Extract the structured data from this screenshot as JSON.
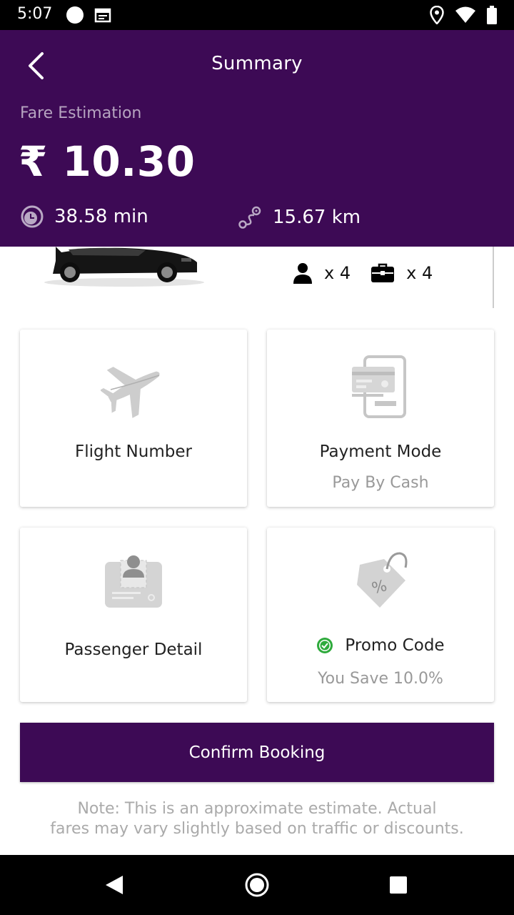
{
  "status_bar": {
    "time": "5:07",
    "icons": [
      "circle-icon",
      "calendar-icon",
      "location-icon",
      "wifi-icon",
      "battery-icon"
    ]
  },
  "header": {
    "title": "Summary",
    "fare_label": "Fare Estimation",
    "fare_value": "₹ 10.30",
    "duration": "38.58 min",
    "distance": "15.67 km",
    "background_color": "#3d0a55"
  },
  "vehicle": {
    "passengers": "x 4",
    "luggage": "x 4"
  },
  "cards": {
    "flight": {
      "title": "Flight Number"
    },
    "payment": {
      "title": "Payment Mode",
      "value": "Pay By Cash"
    },
    "passenger": {
      "title": "Passenger Detail"
    },
    "promo": {
      "title": "Promo Code",
      "value": "You Save 10.0%",
      "status_color": "#2eaa3c"
    }
  },
  "confirm_label": "Confirm Booking",
  "note_line1": "Note: This is an approximate estimate. Actual",
  "note_line2": "fares may vary slightly based on traffic or discounts.",
  "nav": {
    "icons": [
      "back-triangle-icon",
      "home-circle-icon",
      "recents-square-icon"
    ]
  }
}
